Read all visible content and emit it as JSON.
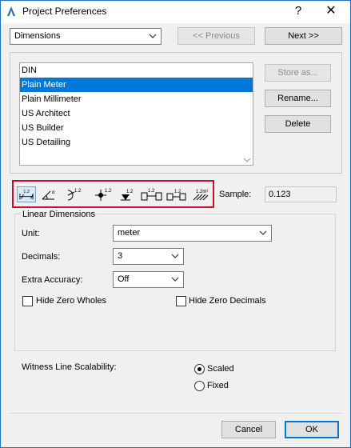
{
  "window": {
    "title": "Project Preferences"
  },
  "titlebar": {
    "help": "?",
    "close": "✕"
  },
  "header": {
    "category": "Dimensions",
    "previous_label": "<< Previous",
    "next_label": "Next >>"
  },
  "presets": {
    "items": [
      "DIN",
      "Plain Meter",
      "Plain Millimeter",
      "US Architect",
      "US Builder",
      "US Detailing"
    ],
    "selected": "Plain Meter"
  },
  "actions": {
    "store_as": "Store as...",
    "rename": "Rename...",
    "delete": "Delete"
  },
  "toolbar": {
    "icons": [
      "linear-dimension-icon",
      "angle-dimension-icon",
      "radial-dimension-icon",
      "level-dimension-icon",
      "elevation-dimension-icon",
      "door-window-dimension-icon",
      "sill-height-dimension-icon",
      "area-dimension-icon"
    ]
  },
  "sample": {
    "label": "Sample:",
    "value": "0.123"
  },
  "linear": {
    "title": "Linear Dimensions",
    "unit_label": "Unit:",
    "unit_value": "meter",
    "decimals_label": "Decimals:",
    "decimals_value": "3",
    "extra_label": "Extra Accuracy:",
    "extra_value": "Off",
    "hide_zero_wholes": "Hide Zero Wholes",
    "hide_zero_decimals": "Hide Zero Decimals"
  },
  "witness": {
    "label": "Witness Line Scalability:",
    "scaled": "Scaled",
    "fixed": "Fixed",
    "selected": "Scaled"
  },
  "footer": {
    "cancel": "Cancel",
    "ok": "OK"
  },
  "colors": {
    "accent": "#0078d7",
    "highlight_box": "#c8102e"
  }
}
